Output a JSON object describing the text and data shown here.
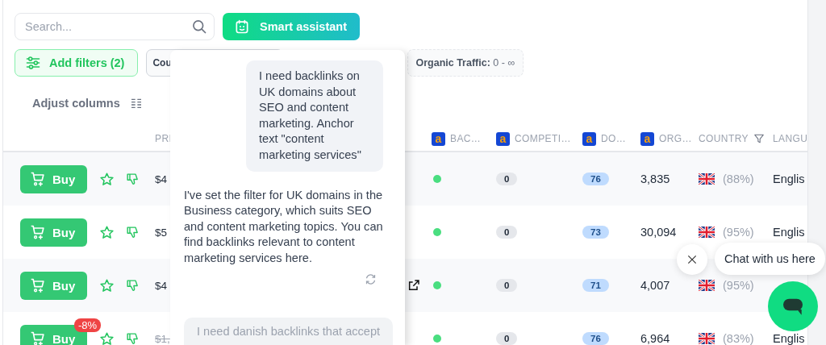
{
  "search": {
    "placeholder": "Search..."
  },
  "assistant_button": {
    "label": "Smart assistant"
  },
  "filters": {
    "add_button": "Add filters (2)",
    "chips": [
      {
        "kind": "plain",
        "label": "Cou"
      },
      {
        "kind": "range",
        "label": "Organic Traffic:",
        "value": "0 - ∞"
      }
    ]
  },
  "adjust_columns": {
    "label": "Adjust columns"
  },
  "table": {
    "columns": [
      {
        "kind": "price",
        "label": "PRI"
      },
      {
        "kind": "backlinks",
        "label": "BAC…",
        "logo": "a"
      },
      {
        "kind": "competition",
        "label": "COMPETI…",
        "logo": "a"
      },
      {
        "kind": "domain",
        "label": "DO…",
        "logo": "a"
      },
      {
        "kind": "organic",
        "label": "ORG…",
        "logo": "a"
      },
      {
        "kind": "country",
        "label": "COUNTRY",
        "filter": true
      },
      {
        "kind": "language",
        "label": "LANGU"
      }
    ],
    "rows": [
      {
        "buy": "Buy",
        "price": "$4",
        "struck": false,
        "external_link": false,
        "color": "#4ade80",
        "competition": "0",
        "domain_rating": "76",
        "traffic": "3,835",
        "country_share": "(88%)",
        "language": "Englis"
      },
      {
        "buy": "Buy",
        "price": "$5",
        "struck": false,
        "external_link": false,
        "color": "#4ade80",
        "competition": "0",
        "domain_rating": "73",
        "traffic": "30,094",
        "country_share": "(95%)",
        "language": "Englis"
      },
      {
        "buy": "Buy",
        "price": "$4",
        "struck": false,
        "external_link": true,
        "color": "#4ade80",
        "competition": "0",
        "domain_rating": "71",
        "traffic": "4,007",
        "country_share": "(95%)"
      },
      {
        "buy": "Buy",
        "discount": "-8%",
        "price": "$1,",
        "struck": true,
        "external_link": false,
        "color": "#4ade80",
        "competition": "0",
        "domain_rating": "76",
        "traffic": "6,964",
        "country_share": "(83%)",
        "language": "Englis"
      }
    ]
  },
  "assistant": {
    "messages": [
      {
        "kind": "user",
        "text": "I need backlinks on UK domains about SEO and content marketing. Anchor text \"content marketing services\""
      },
      {
        "kind": "assistant",
        "text": "I've set the filter for UK domains in the Business category, which suits SEO and content marketing topics. You can find backlinks relevant to content marketing services here."
      }
    ],
    "suggestion": "I need danish backlinks that accept"
  },
  "chat": {
    "prompt": "Chat with us here"
  }
}
